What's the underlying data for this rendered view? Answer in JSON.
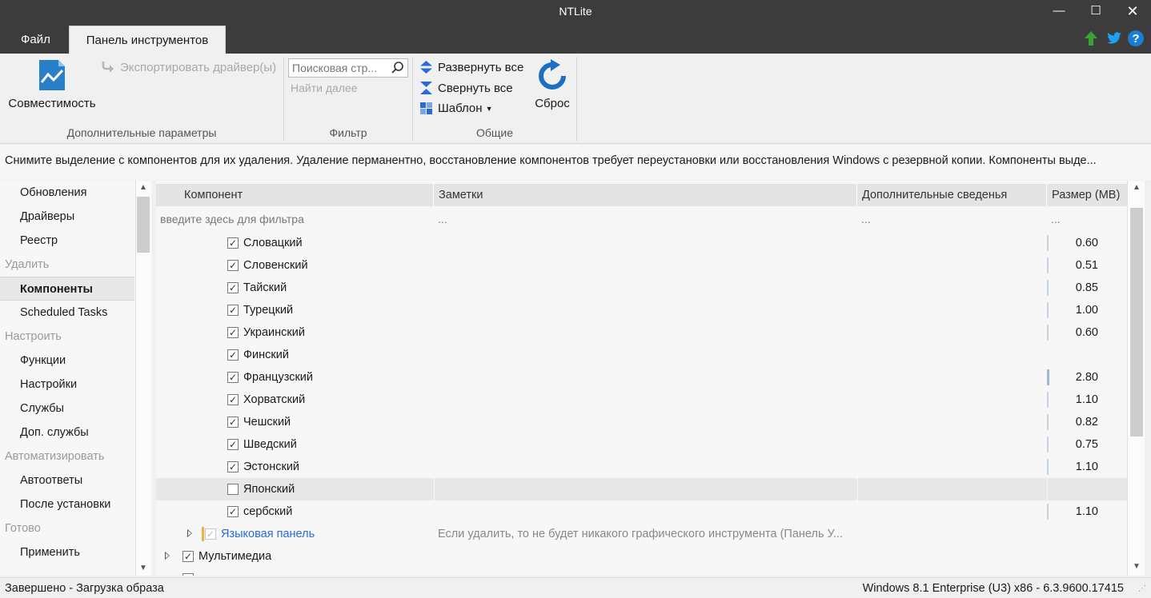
{
  "window": {
    "title": "NTLite",
    "minimize": "—",
    "maximize": "☐",
    "close": "✕"
  },
  "ribbon_tabs": {
    "file": "Файл",
    "toolbar": "Панель инструментов"
  },
  "ribbon": {
    "compat_label": "Совместимость",
    "export_label": "Экспортировать драйвер(ы)",
    "group_advanced": "Дополнительные параметры",
    "search_placeholder": "Поисковая стр...",
    "find_next": "Найти далее",
    "group_filter": "Фильтр",
    "expand_all": "Развернуть все",
    "collapse_all": "Свернуть все",
    "template": "Шаблон",
    "reset": "Сброс",
    "group_general": "Общие"
  },
  "info_text": "Снимите выделение с компонентов для их удаления. Удаление перманентно, восстановление компонентов требует переустановки или восстановления Windows с резервной копии. Компоненты выде...",
  "sidebar": {
    "items": [
      {
        "label": "Обновления",
        "type": "item"
      },
      {
        "label": "Драйверы",
        "type": "item"
      },
      {
        "label": "Реестр",
        "type": "item"
      },
      {
        "label": "Удалить",
        "type": "section"
      },
      {
        "label": "Компоненты",
        "type": "selected"
      },
      {
        "label": "Scheduled Tasks",
        "type": "item"
      },
      {
        "label": "Настроить",
        "type": "section"
      },
      {
        "label": "Функции",
        "type": "item"
      },
      {
        "label": "Настройки",
        "type": "item"
      },
      {
        "label": "Службы",
        "type": "item"
      },
      {
        "label": "Доп. службы",
        "type": "item"
      },
      {
        "label": "Автоматизировать",
        "type": "section"
      },
      {
        "label": "Автоответы",
        "type": "item"
      },
      {
        "label": "После установки",
        "type": "item"
      },
      {
        "label": "Готово",
        "type": "section"
      },
      {
        "label": "Применить",
        "type": "item"
      }
    ]
  },
  "grid": {
    "columns": [
      "Компонент",
      "Заметки",
      "Дополнительные сведенья",
      "Размер (MB)"
    ],
    "filter": {
      "component": "введите здесь для фильтра",
      "notes": "...",
      "info": "...",
      "size": "..."
    },
    "rows": [
      {
        "name": "Словацкий",
        "checked": true,
        "size": "0.60"
      },
      {
        "name": "Словенский",
        "checked": true,
        "size": "0.51"
      },
      {
        "name": "Тайский",
        "checked": true,
        "size": "0.85"
      },
      {
        "name": "Турецкий",
        "checked": true,
        "size": "1.00"
      },
      {
        "name": "Украинский",
        "checked": true,
        "size": "0.60"
      },
      {
        "name": "Финский",
        "checked": true,
        "size": ""
      },
      {
        "name": "Французский",
        "checked": true,
        "size": "2.80"
      },
      {
        "name": "Хорватский",
        "checked": true,
        "size": "1.10"
      },
      {
        "name": "Чешский",
        "checked": true,
        "size": "0.82"
      },
      {
        "name": "Шведский",
        "checked": true,
        "size": "0.75"
      },
      {
        "name": "Эстонский",
        "checked": true,
        "size": "1.10"
      },
      {
        "name": "Японский",
        "checked": false,
        "size": ""
      },
      {
        "name": "сербский",
        "checked": true,
        "size": "1.10"
      }
    ],
    "lang_panel": {
      "name": "Языковая панель",
      "note": "Если удалить, то не будет никакого графического инструмента (Панель У..."
    },
    "multimedia": {
      "name": "Мультимедиа"
    }
  },
  "status": {
    "left": "Завершено - Загрузка образа",
    "right": "Windows 8.1 Enterprise (U3) x86 - 6.3.9600.17415"
  },
  "colors": {
    "titlebar": "#3c3c3c",
    "accent": "#2a6ad8",
    "upload_green": "#3aa23a",
    "twitter_blue": "#1da1f2"
  }
}
